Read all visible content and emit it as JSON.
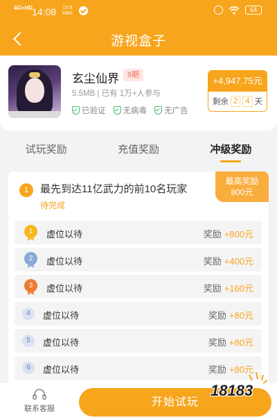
{
  "status_bar": {
    "signal": "4G+HD",
    "time": "14:08",
    "speed_value": "15.9",
    "speed_unit": "KB/s",
    "battery": "64",
    "icons": [
      "signal-icon",
      "check-circle-icon",
      "alarm-icon",
      "wifi-icon",
      "battery-icon"
    ]
  },
  "header": {
    "title": "游视盒子",
    "back_icon": "chevron-left-icon"
  },
  "game": {
    "name": "玄尘仙界",
    "period": "9期",
    "meta": "5.5MB | 已有 1万+人参与",
    "tags": [
      {
        "label": "已验证",
        "icon": "shield-check-icon"
      },
      {
        "label": "无病毒",
        "icon": "shield-check-icon"
      },
      {
        "label": "无广告",
        "icon": "shield-check-icon"
      }
    ],
    "reward_amount": "+4,947.75元",
    "remaining_prefix": "剩余",
    "remaining_days_1": "2",
    "remaining_days_2": "4",
    "remaining_suffix": "天"
  },
  "tabs": [
    {
      "label": "试玩奖励",
      "active": false
    },
    {
      "label": "充值奖励",
      "active": false
    },
    {
      "label": "冲级奖励",
      "active": true
    }
  ],
  "task": {
    "number": "1",
    "title": "最先到达11亿武力的前10名玩家",
    "status": "待完成",
    "max_reward_label": "最高奖励",
    "max_reward_value": "800元"
  },
  "ranking": [
    {
      "rank": "1",
      "name": "虚位以待",
      "reward_label": "奖励",
      "reward": "+800元",
      "medal": "gold"
    },
    {
      "rank": "2",
      "name": "虚位以待",
      "reward_label": "奖励",
      "reward": "+400元",
      "medal": "silver"
    },
    {
      "rank": "3",
      "name": "虚位以待",
      "reward_label": "奖励",
      "reward": "+160元",
      "medal": "bronze"
    },
    {
      "rank": "4",
      "name": "虚位以待",
      "reward_label": "奖励",
      "reward": "+80元",
      "medal": ""
    },
    {
      "rank": "5",
      "name": "虚位以待",
      "reward_label": "奖励",
      "reward": "+80元",
      "medal": ""
    },
    {
      "rank": "6",
      "name": "虚位以待",
      "reward_label": "奖励",
      "reward": "+80元",
      "medal": ""
    }
  ],
  "bottom": {
    "service_label": "联系客服",
    "service_icon": "headset-icon",
    "start_label": "开始试玩",
    "watermark": "18183"
  },
  "colors": {
    "accent": "#f7a51c",
    "green": "#3fbf6a",
    "badge_red": "#f06d5c"
  }
}
